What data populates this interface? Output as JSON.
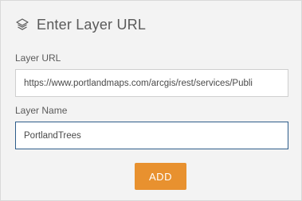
{
  "panel": {
    "title": "Enter Layer URL",
    "header_icon": "layers-icon"
  },
  "form": {
    "url_label": "Layer URL",
    "url_value": "https://www.portlandmaps.com/arcgis/rest/services/Publi",
    "name_label": "Layer Name",
    "name_value": "PortlandTrees",
    "add_label": "ADD"
  },
  "colors": {
    "panel_background": "#f3f3f3",
    "accent_button": "#e8912f",
    "focused_border": "#2e5d8a"
  }
}
